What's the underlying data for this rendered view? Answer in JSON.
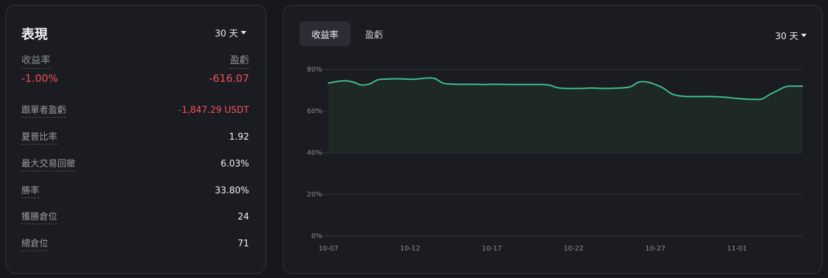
{
  "performance": {
    "title": "表現",
    "period": "30 天",
    "headline": [
      {
        "label": "收益率",
        "value": "-1.00%"
      },
      {
        "label": "盈虧",
        "value": "-616.07"
      }
    ],
    "metrics": [
      {
        "label": "跟單者盈虧",
        "value": "-1,847.29 USDT",
        "negative": true
      },
      {
        "label": "夏普比率",
        "value": "1.92",
        "negative": false
      },
      {
        "label": "最大交易回撤",
        "value": "6.03%",
        "negative": false
      },
      {
        "label": "勝率",
        "value": "33.80%",
        "negative": false
      },
      {
        "label": "獲勝倉位",
        "value": "24",
        "negative": false
      },
      {
        "label": "總倉位",
        "value": "71",
        "negative": false
      }
    ]
  },
  "chart_panel": {
    "tabs": [
      "收益率",
      "盈虧"
    ],
    "active_tab": 0,
    "period": "30 天"
  },
  "chart_data": {
    "type": "area",
    "ylim": [
      0,
      80
    ],
    "y_ticks": [
      "0%",
      "20%",
      "40%",
      "60%",
      "80%"
    ],
    "y_tick_values": [
      0,
      20,
      40,
      60,
      80
    ],
    "x_tick_labels": [
      "10-07",
      "10-12",
      "10-17",
      "10-22",
      "10-27",
      "11-01"
    ],
    "x_tick_days": [
      0,
      5,
      10,
      15,
      20,
      25
    ],
    "baseline": 40,
    "x": [
      0,
      0.5,
      1,
      1.5,
      2,
      2.5,
      3,
      3.5,
      4,
      4.5,
      5,
      5.5,
      6,
      6.5,
      7,
      7.5,
      8,
      8.5,
      9,
      9.5,
      10,
      10.5,
      11,
      11.5,
      12,
      12.5,
      13,
      13.5,
      14,
      14.5,
      15,
      15.5,
      16,
      16.5,
      17,
      17.5,
      18,
      18.5,
      19,
      19.5,
      20,
      20.5,
      21,
      21.5,
      22,
      22.5,
      23,
      23.5,
      24,
      24.5,
      25,
      25.5,
      26,
      26.5,
      27,
      27.5,
      28,
      28.5,
      29
    ],
    "values": [
      73.5,
      74.2,
      74.6,
      74.0,
      72.6,
      73.0,
      75.0,
      75.4,
      75.5,
      75.5,
      75.3,
      75.5,
      75.9,
      75.7,
      73.5,
      73.0,
      72.9,
      72.9,
      72.9,
      72.8,
      72.9,
      72.9,
      72.8,
      72.8,
      72.8,
      72.8,
      72.8,
      72.5,
      71.3,
      70.9,
      70.9,
      70.9,
      71.1,
      71.0,
      70.9,
      71.0,
      71.2,
      71.8,
      74.0,
      74.0,
      72.8,
      71.0,
      68.3,
      67.3,
      67.0,
      67.0,
      67.0,
      67.0,
      66.8,
      66.5,
      66.1,
      65.8,
      65.7,
      65.8,
      68.0,
      70.0,
      71.8,
      72.0,
      72.0
    ],
    "line_color": "#3dc48e"
  }
}
